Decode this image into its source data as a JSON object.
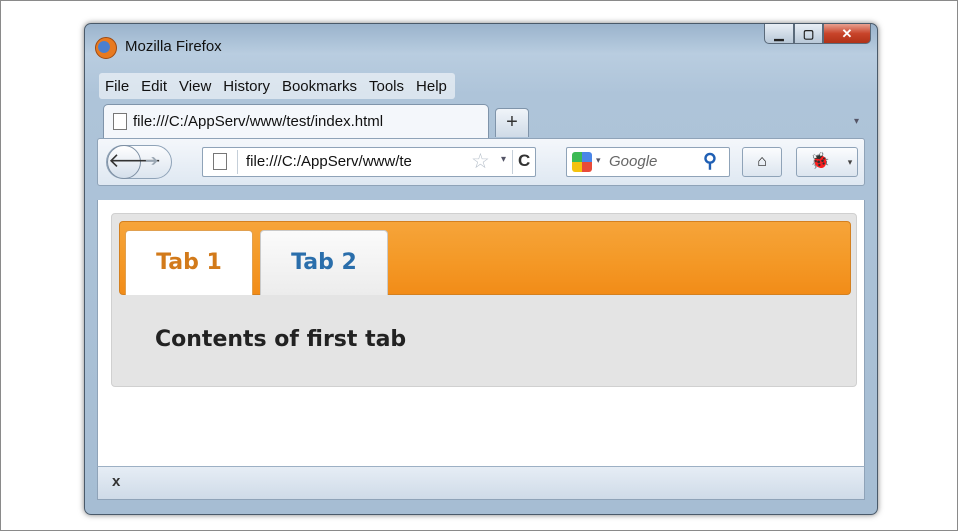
{
  "window": {
    "title": "Mozilla Firefox",
    "buttons": {
      "minimize": "▁",
      "maximize": "▢",
      "close": "✕"
    }
  },
  "menubar": {
    "items": [
      "File",
      "Edit",
      "View",
      "History",
      "Bookmarks",
      "Tools",
      "Help"
    ]
  },
  "browser_tabs": {
    "active_title": "file:///C:/AppServ/www/test/index.html",
    "new_tab_label": "+",
    "list_arrow": "▾"
  },
  "navbar": {
    "back_glyph": "🡐",
    "forward_glyph": "➔",
    "url": "file:///C:/AppServ/www/te",
    "star_glyph": "☆",
    "dropdown_glyph": "▾",
    "reload_glyph": "C",
    "search_engine": "Google",
    "search_engine_dropdown": "▾",
    "search_glyph": "⚲",
    "home_glyph": "⌂",
    "addon_glyph": "🐞"
  },
  "page": {
    "tabs": [
      {
        "label": "Tab 1",
        "active": true
      },
      {
        "label": "Tab 2",
        "active": false
      }
    ],
    "content_text": "Contents of first tab",
    "accent_color": "#f49a28",
    "active_tab_text_color": "#d27a1a",
    "inactive_tab_text_color": "#2a6eab"
  },
  "statusbar": {
    "close_label": "x"
  }
}
